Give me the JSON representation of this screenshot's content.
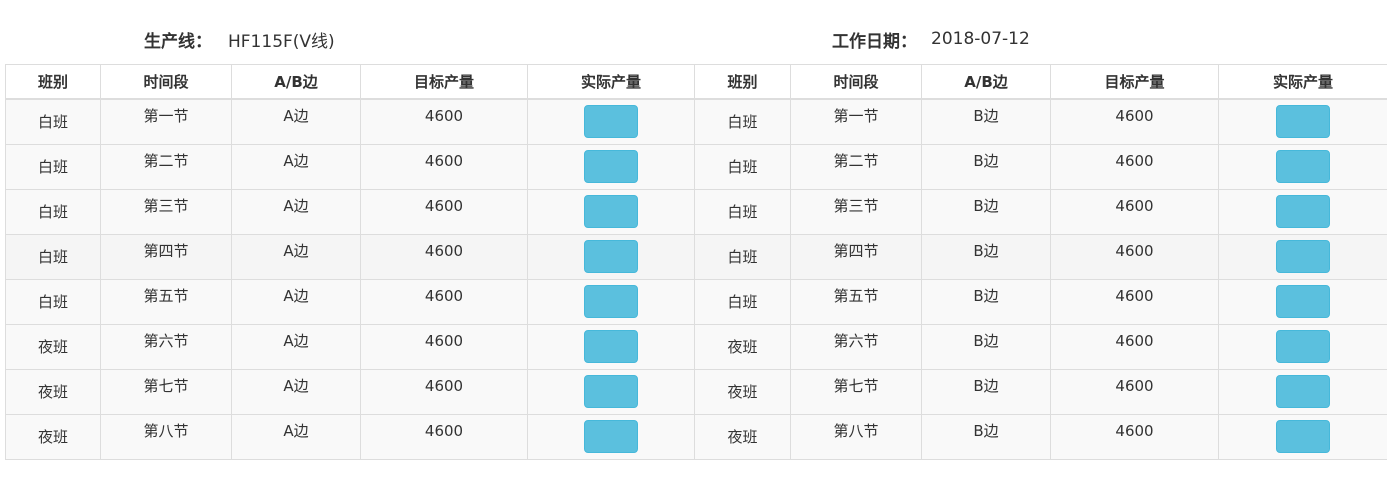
{
  "header": {
    "line_label": "生产线：",
    "line_value": "HF115F(V线)",
    "date_label": "工作日期：",
    "date_value": "2018-07-12"
  },
  "table": {
    "columns": [
      "班别",
      "时间段",
      "A/B边",
      "目标产量",
      "实际产量",
      "班别",
      "时间段",
      "A/B边",
      "目标产量",
      "实际产量"
    ],
    "rows": [
      {
        "left": {
          "shift": "白班",
          "period": "第一节",
          "side": "A边",
          "target": "4600",
          "actual": ""
        },
        "right": {
          "shift": "白班",
          "period": "第一节",
          "side": "B边",
          "target": "4600",
          "actual": ""
        }
      },
      {
        "left": {
          "shift": "白班",
          "period": "第二节",
          "side": "A边",
          "target": "4600",
          "actual": ""
        },
        "right": {
          "shift": "白班",
          "period": "第二节",
          "side": "B边",
          "target": "4600",
          "actual": ""
        }
      },
      {
        "left": {
          "shift": "白班",
          "period": "第三节",
          "side": "A边",
          "target": "4600",
          "actual": ""
        },
        "right": {
          "shift": "白班",
          "period": "第三节",
          "side": "B边",
          "target": "4600",
          "actual": ""
        }
      },
      {
        "left": {
          "shift": "白班",
          "period": "第四节",
          "side": "A边",
          "target": "4600",
          "actual": ""
        },
        "right": {
          "shift": "白班",
          "period": "第四节",
          "side": "B边",
          "target": "4600",
          "actual": ""
        }
      },
      {
        "left": {
          "shift": "白班",
          "period": "第五节",
          "side": "A边",
          "target": "4600",
          "actual": ""
        },
        "right": {
          "shift": "白班",
          "period": "第五节",
          "side": "B边",
          "target": "4600",
          "actual": ""
        }
      },
      {
        "left": {
          "shift": "夜班",
          "period": "第六节",
          "side": "A边",
          "target": "4600",
          "actual": ""
        },
        "right": {
          "shift": "夜班",
          "period": "第六节",
          "side": "B边",
          "target": "4600",
          "actual": ""
        }
      },
      {
        "left": {
          "shift": "夜班",
          "period": "第七节",
          "side": "A边",
          "target": "4600",
          "actual": ""
        },
        "right": {
          "shift": "夜班",
          "period": "第七节",
          "side": "B边",
          "target": "4600",
          "actual": ""
        }
      },
      {
        "left": {
          "shift": "夜班",
          "period": "第八节",
          "side": "A边",
          "target": "4600",
          "actual": ""
        },
        "right": {
          "shift": "夜班",
          "period": "第八节",
          "side": "B边",
          "target": "4600",
          "actual": ""
        }
      }
    ]
  },
  "colors": {
    "button_fill": "#5bc0de",
    "button_border": "#46b8da",
    "grid_border": "#dddddd",
    "row_bg": "#f9f9f9"
  }
}
